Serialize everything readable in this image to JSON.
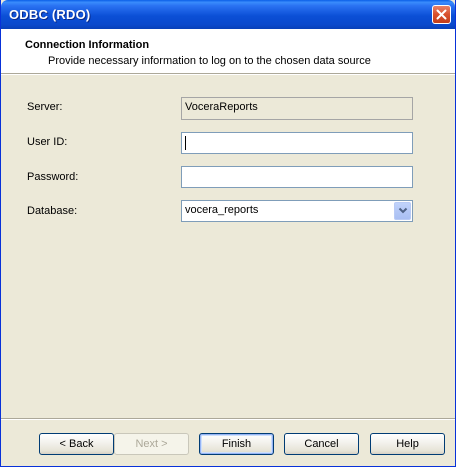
{
  "window": {
    "title": "ODBC (RDO)"
  },
  "header": {
    "title": "Connection Information",
    "subtitle": "Provide necessary information to log on to the chosen data source"
  },
  "form": {
    "server_label": "Server:",
    "server_value": "VoceraReports",
    "userid_label": "User ID:",
    "userid_value": "",
    "password_label": "Password:",
    "password_value": "",
    "database_label": "Database:",
    "database_value": "vocera_reports"
  },
  "buttons": {
    "back": "< Back",
    "next": "Next >",
    "finish": "Finish",
    "cancel": "Cancel",
    "help": "Help"
  },
  "colors": {
    "titlebar": "#0a49cc",
    "dialog_bg": "#ece9d8"
  }
}
